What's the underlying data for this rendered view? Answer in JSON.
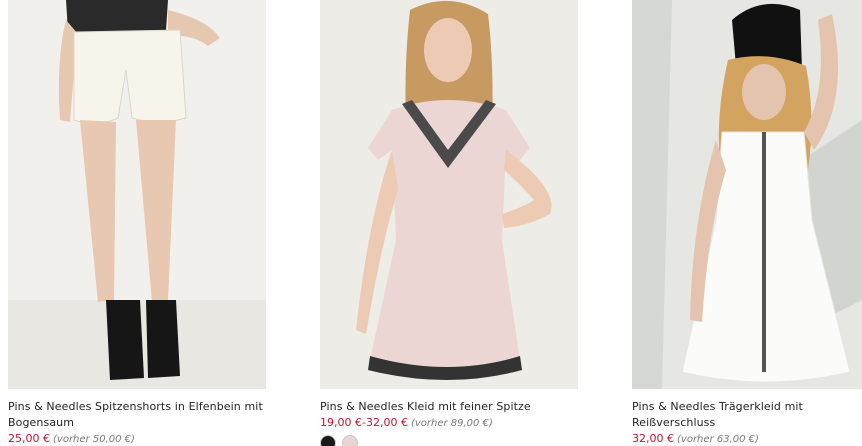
{
  "products": [
    {
      "name": "Pins & Needles Spitzenshorts in Elfenbein mit Bogensaum",
      "price": "25,00 €",
      "old_price": "(vorher 50,00 €)"
    },
    {
      "name": "Pins & Needles Kleid mit feiner Spitze",
      "price": "19,00 €-32,00 €",
      "old_price": "(vorher 89,00 €)",
      "swatches": [
        "#1a1a1a",
        "#e8d6d6"
      ]
    },
    {
      "name": "Pins & Needles Trägerkleid mit Reißverschluss",
      "price": "32,00 €",
      "old_price": "(vorher 63,00 €)"
    }
  ],
  "colors": {
    "sale_price": "#c8102e",
    "old_price": "#777777"
  }
}
